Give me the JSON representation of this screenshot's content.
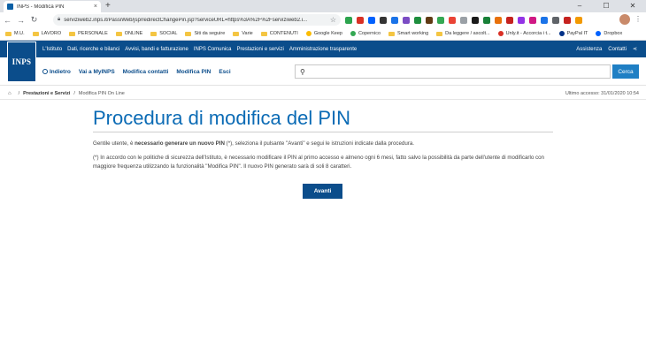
{
  "browser": {
    "tab_title": "INPS - Modifica PIN",
    "tab_close": "×",
    "new_tab": "+",
    "window_controls": [
      "–",
      "☐",
      "✕"
    ],
    "url": "serviziweb2.inps.it/PassiWeb/jsp/redirectChangePin.jsp?serviceURL=https%3A%2F%2Fserviziweb2.i...",
    "bookmarks": [
      {
        "label": "M.U.",
        "icon": "folder"
      },
      {
        "label": "LAVORO",
        "icon": "folder"
      },
      {
        "label": "PERSONALE",
        "icon": "folder"
      },
      {
        "label": "ONLINE",
        "icon": "folder"
      },
      {
        "label": "SOCIAL",
        "icon": "folder"
      },
      {
        "label": "Siti da seguire",
        "icon": "folder"
      },
      {
        "label": "Varie",
        "icon": "folder"
      },
      {
        "label": "CONTENUTI",
        "icon": "folder"
      },
      {
        "label": "Google Keep",
        "icon": "keep"
      },
      {
        "label": "Copernico",
        "icon": "site"
      },
      {
        "label": "Smart working",
        "icon": "folder"
      },
      {
        "label": "Da leggere / ascolt...",
        "icon": "folder"
      },
      {
        "label": "Unly.it - Accorcia i t...",
        "icon": "site"
      },
      {
        "label": "PayPal IT",
        "icon": "paypal"
      },
      {
        "label": "Dropbox",
        "icon": "dropbox"
      }
    ]
  },
  "inps": {
    "logo_text": "INPS",
    "top_nav": [
      "L'Istituto",
      "Dati, ricerche e bilanci",
      "Avvisi, bandi e fatturazione",
      "INPS Comunica",
      "Prestazioni e servizi",
      "Amministrazione trasparente"
    ],
    "top_right": [
      "Assistenza",
      "Contatti"
    ],
    "sub_nav": {
      "back": "Indietro",
      "items": [
        "Vai a MyINPS",
        "Modifica contatti",
        "Modifica PIN",
        "Esci"
      ]
    },
    "search_button": "Cerca"
  },
  "breadcrumb": {
    "level1": "Prestazioni e Servizi",
    "level2": "Modifica PIN On Line",
    "last_access": "Ultimo accesso: 31/01/2020 10:54"
  },
  "content": {
    "title": "Procedura di modifica del PIN",
    "p1_prefix": "Gentile utente, è ",
    "p1_bold": "necessario generare un nuovo PIN",
    "p1_suffix": " (*), seleziona il pulsante \"Avanti\" e segui le istruzioni indicate dalla procedura.",
    "p2": "(*) In accordo con le politiche di sicurezza dell'Istituto, è necessario modificare il PIN al primo accesso e almeno ogni 6 mesi, fatto salvo la possibilità da parte dell'utente di modificarlo con maggiore frequenza utilizzando la funzionalità \"Modifica PIN\". Il nuovo PIN generato sarà di soli 8 caratteri.",
    "button": "Avanti"
  },
  "colors": {
    "brand_blue": "#0b4d8b",
    "title_blue": "#0b6bb5",
    "search_button": "#1f7fc4"
  }
}
